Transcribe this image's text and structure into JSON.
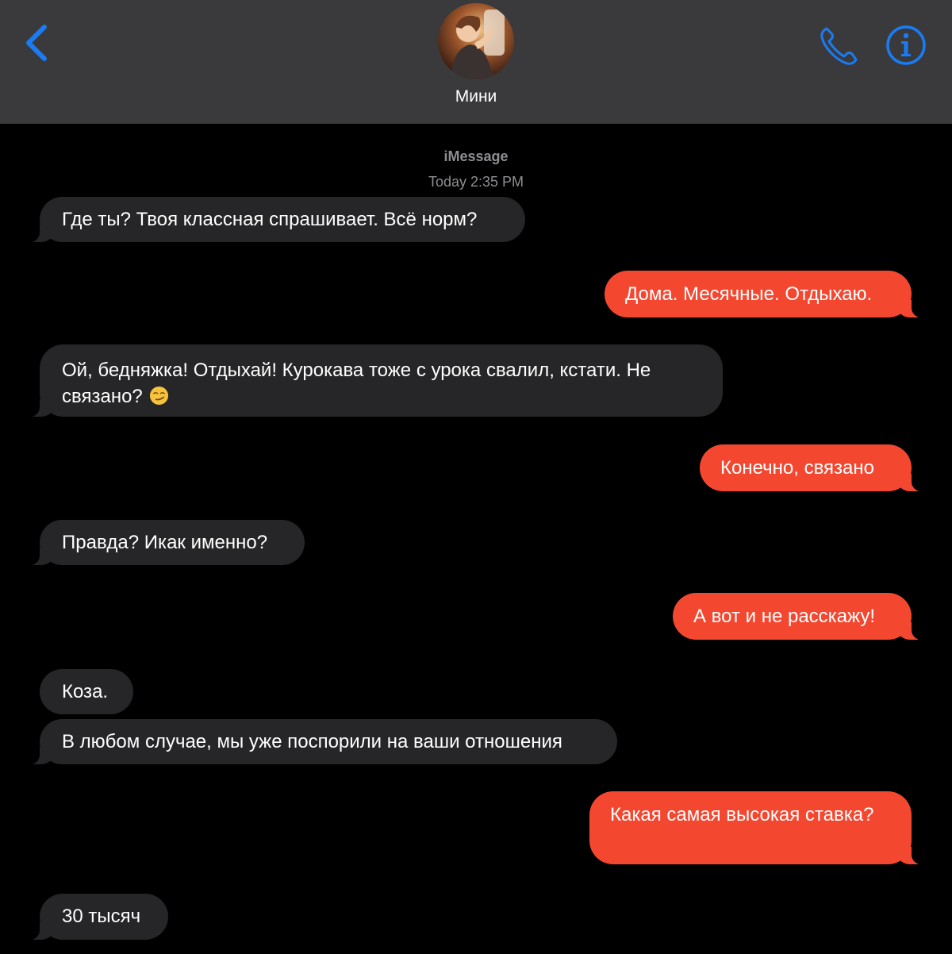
{
  "header": {
    "contact_name": "Мини",
    "back_icon": "chevron-left-icon",
    "call_icon": "phone-icon",
    "info_icon": "info-icon",
    "accent_color": "#1a7cf5"
  },
  "conversation": {
    "service": "iMessage",
    "timestamp": "Today 2:35 PM"
  },
  "messages": [
    {
      "direction": "in",
      "text": "Где ты? Твоя классная спрашивает. Всё норм?"
    },
    {
      "direction": "out",
      "text": "Дома. Месячные. Отдыхаю."
    },
    {
      "direction": "in",
      "text": "Ой, бедняжка! Отдыхай! Курокава тоже с урока свалил, кстати. Не",
      "text2": "связано?",
      "emoji": "smirking-face-emoji"
    },
    {
      "direction": "out",
      "text": "Конечно, связано"
    },
    {
      "direction": "in",
      "text": "Правда? Икак именно?"
    },
    {
      "direction": "out",
      "text": "А вот и не расскажу!"
    },
    {
      "direction": "in",
      "text": "Коза."
    },
    {
      "direction": "in",
      "text": "В любом случае, мы уже поспорили на ваши отношения"
    },
    {
      "direction": "out",
      "text": "Какая самая высокая ставка?"
    },
    {
      "direction": "in",
      "text": "30 тысяч"
    }
  ],
  "colors": {
    "incoming_bubble": "#262628",
    "outgoing_bubble": "#f44730",
    "header_bg": "#3a3a3c",
    "meta_text": "#8e8e93"
  }
}
